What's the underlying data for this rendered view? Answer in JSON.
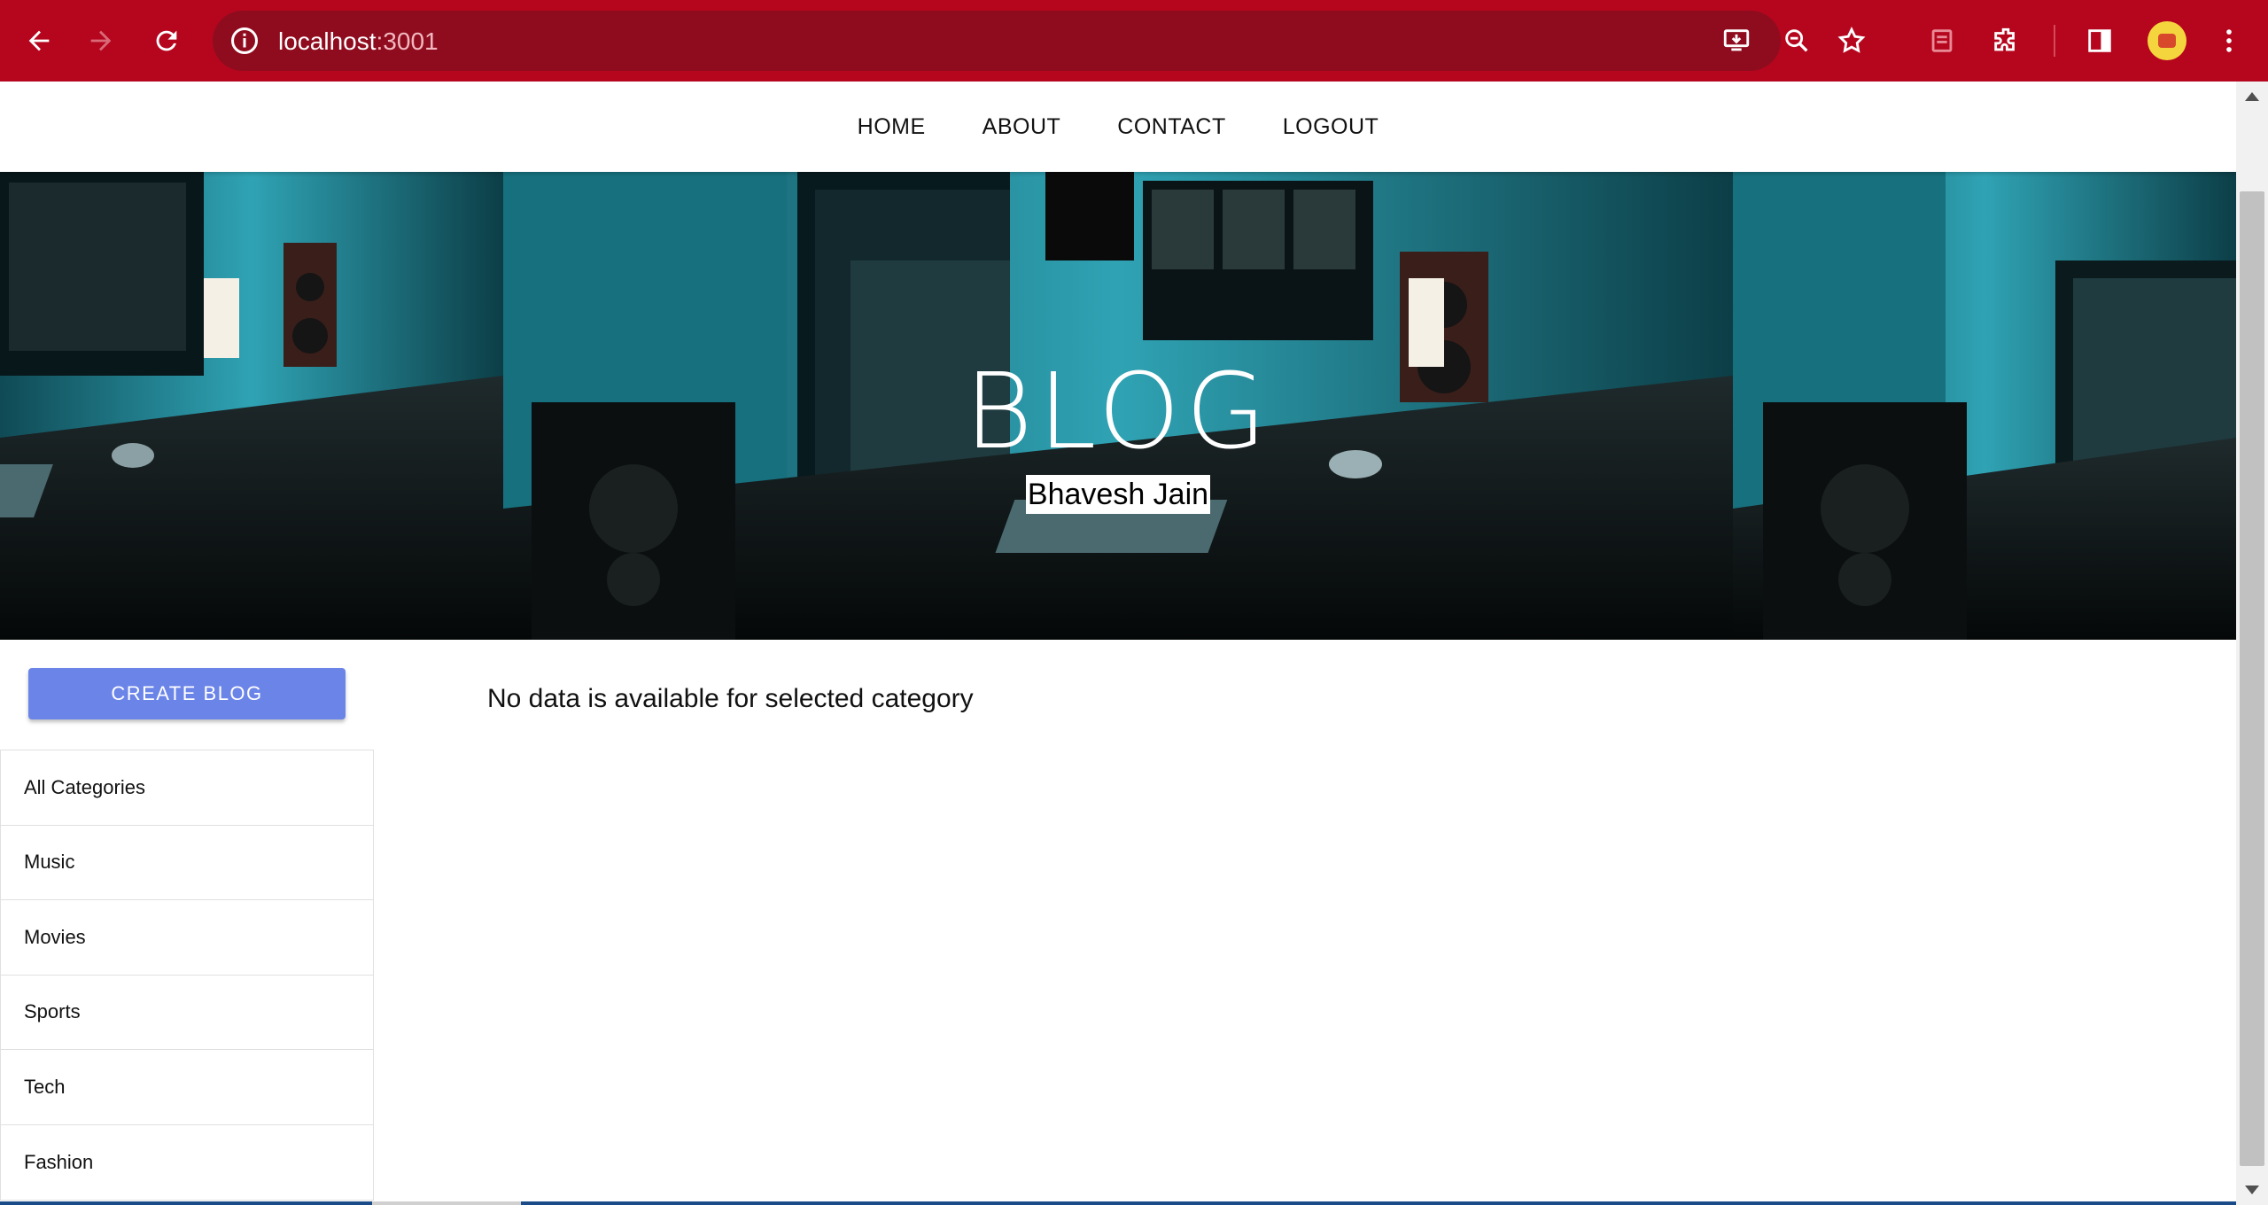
{
  "browser": {
    "url_host": "localhost",
    "url_port": ":3001",
    "colors": {
      "frame": "#b5061e",
      "omnibox": "#8f0c1f"
    },
    "icons": [
      "back-icon",
      "forward-icon",
      "reload-icon",
      "info-icon",
      "install-app-icon",
      "zoom-icon",
      "star-icon",
      "reading-list-icon",
      "extensions-icon",
      "side-panel-icon",
      "profile-avatar",
      "menu-icon"
    ]
  },
  "nav": {
    "items": [
      "HOME",
      "ABOUT",
      "CONTACT",
      "LOGOUT"
    ]
  },
  "banner": {
    "title": "BLOG",
    "subtitle": "Bhavesh Jain"
  },
  "sidebar": {
    "create_label": "CREATE BLOG",
    "create_color": "#6b84e8",
    "categories": [
      "All Categories",
      "Music",
      "Movies",
      "Sports",
      "Tech",
      "Fashion"
    ]
  },
  "main": {
    "empty_message": "No data is available for selected category"
  }
}
